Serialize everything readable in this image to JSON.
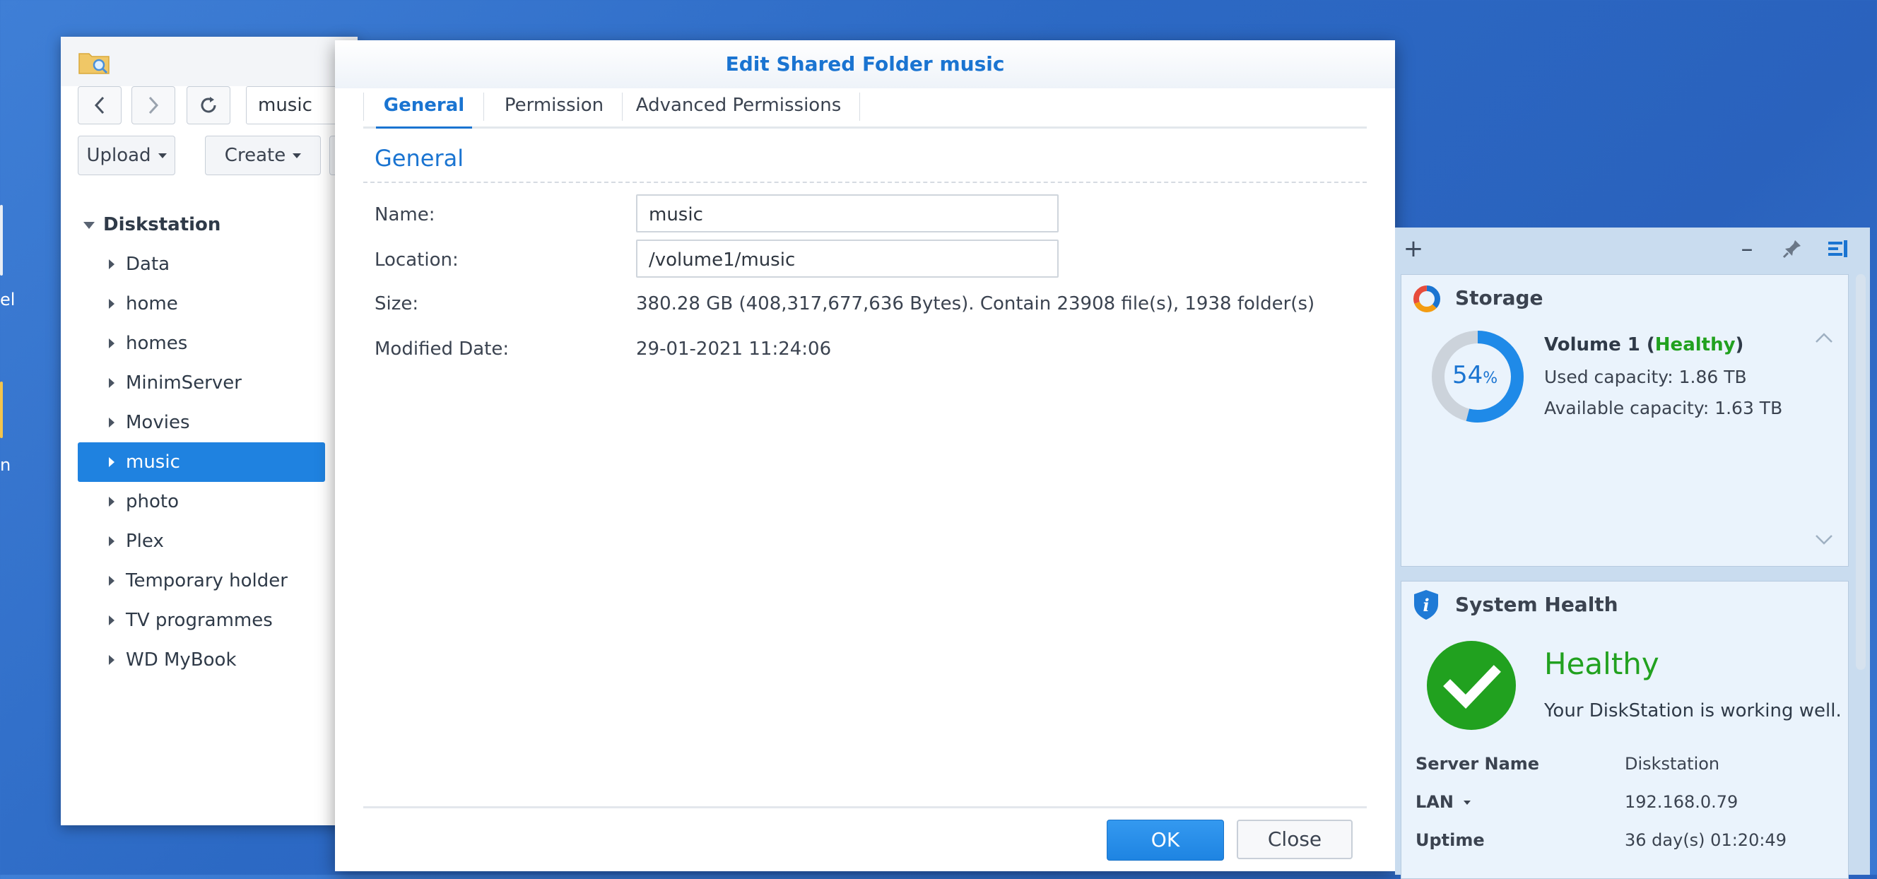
{
  "desktop": {
    "labels": [
      "el",
      "n"
    ]
  },
  "file_station": {
    "path_value": "music",
    "upload_label": "Upload",
    "create_label": "Create",
    "tree_root": "Diskstation",
    "tree_items": [
      "Data",
      "home",
      "homes",
      "MinimServer",
      "Movies",
      "music",
      "photo",
      "Plex",
      "Temporary holder",
      "TV programmes",
      "WD MyBook"
    ],
    "selected_item": "music"
  },
  "dialog": {
    "title": "Edit Shared Folder music",
    "tabs": [
      "General",
      "Permission",
      "Advanced Permissions"
    ],
    "active_tab": "General",
    "section_title": "General",
    "fields": {
      "name_label": "Name:",
      "name_value": "music",
      "location_label": "Location:",
      "location_value": "/volume1/music",
      "size_label": "Size:",
      "size_value": "380.28 GB (408,317,677,636 Bytes). Contain 23908 file(s), 1938 folder(s)",
      "modified_label": "Modified Date:",
      "modified_value": "29-01-2021 11:24:06"
    },
    "ok_label": "OK",
    "close_label": "Close"
  },
  "widgets": {
    "storage": {
      "title": "Storage",
      "percent": "54",
      "percent_unit": "%",
      "used_fraction": 0.54,
      "volume_name": "Volume 1 (",
      "volume_status": "Healthy",
      "volume_close": ")",
      "used_capacity": "Used capacity: 1.86 TB",
      "available_capacity": "Available capacity: 1.63 TB"
    },
    "system_health": {
      "title": "System Health",
      "status": "Healthy",
      "description": "Your DiskStation is working well.",
      "server_name_label": "Server Name",
      "server_name_value": "Diskstation",
      "lan_label": "LAN",
      "lan_value": "192.168.0.79",
      "uptime_label": "Uptime",
      "uptime_value": "36 day(s) 01:20:49"
    }
  },
  "colors": {
    "accent": "#1a74d1",
    "selection": "#1f82e0",
    "healthy": "#21a11f",
    "desktop": "#2c69c4"
  }
}
